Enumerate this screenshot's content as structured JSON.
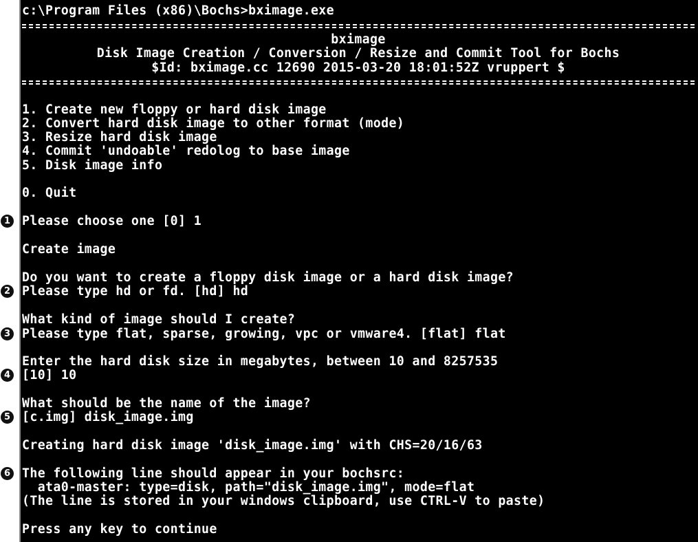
{
  "window": {
    "prompt_command": "c:\\Program Files (x86)\\Bochs>bximage.exe"
  },
  "banner": {
    "name": "bximage",
    "subtitle": "Disk Image Creation / Conversion / Resize and Commit Tool for Bochs",
    "version_id": "$Id: bximage.cc 12690 2015-03-20 18:01:52Z vruppert $"
  },
  "menu": {
    "items": [
      "1. Create new floppy or hard disk image",
      "2. Convert hard disk image to other format (mode)",
      "3. Resize hard disk image",
      "4. Commit 'undoable' redolog to base image",
      "5. Disk image info"
    ],
    "quit": "0. Quit"
  },
  "session": {
    "choose": "Please choose one [0] 1",
    "create_image": "Create image",
    "floppy_or_hd_question": "Do you want to create a floppy disk image or a hard disk image?",
    "floppy_or_hd_answer": "Please type hd or fd. [hd] hd",
    "kind_question": "What kind of image should I create?",
    "kind_answer": "Please type flat, sparse, growing, vpc or vmware4. [flat] flat",
    "size_question": "Enter the hard disk size in megabytes, between 10 and 8257535",
    "size_answer": "[10] 10",
    "name_question": "What should be the name of the image?",
    "name_answer": "[c.img] disk_image.img",
    "creating": "Creating hard disk image 'disk_image.img' with CHS=20/16/63",
    "bochsrc_intro": "The following line should appear in your bochsrc:",
    "bochsrc_line": "  ata0-master: type=disk, path=\"disk_image.img\", mode=flat",
    "clipboard_note": "(The line is stored in your windows clipboard, use CTRL-V to paste)",
    "press_key": "Press any key to continue"
  },
  "markers": [
    "1",
    "2",
    "3",
    "4",
    "5",
    "6"
  ],
  "colors": {
    "console_background": "#000000",
    "console_text": "#ffffff",
    "marker_fill": "#111111",
    "page_background": "#ffffff"
  }
}
